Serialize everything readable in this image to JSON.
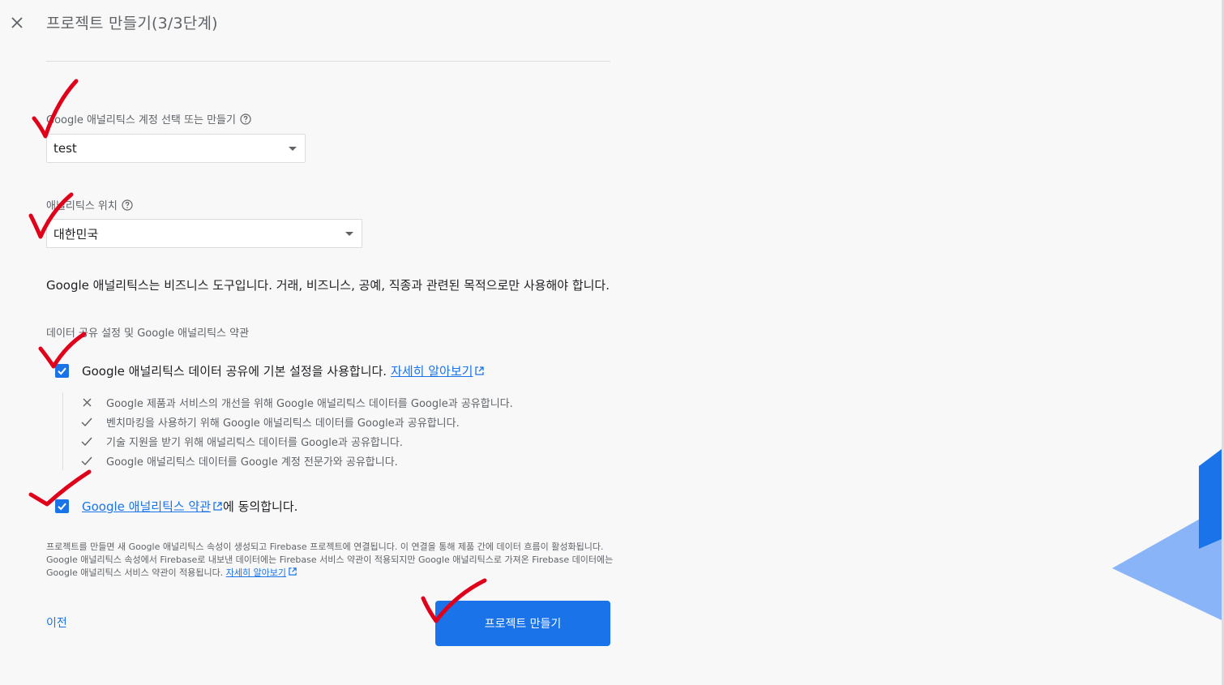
{
  "header": {
    "close_icon": "close-icon",
    "title": "프로젝트 만들기(3/3단계)"
  },
  "account_field": {
    "label": "Google 애널리틱스 계정 선택 또는 만들기",
    "value": "test"
  },
  "location_field": {
    "label": "애널리틱스 위치",
    "value": "대한민국"
  },
  "notice": "Google 애널리틱스는 비즈니스 도구입니다. 거래, 비즈니스, 공예, 직종과 관련된 목적으로만 사용해야 합니다.",
  "data_sharing": {
    "section_label": "데이터 공유 설정 및 Google 애널리틱스 약관",
    "checkbox_text": "Google 애널리틱스 데이터 공유에 기본 설정을 사용합니다.",
    "learn_more": "자세히 알아보기",
    "checked": true,
    "items": [
      {
        "icon": "x-icon",
        "text": "Google 제품과 서비스의 개선을 위해 Google 애널리틱스 데이터를 Google과 공유합니다."
      },
      {
        "icon": "check-icon",
        "text": "벤치마킹을 사용하기 위해 Google 애널리틱스 데이터를 Google과 공유합니다."
      },
      {
        "icon": "check-icon",
        "text": "기술 지원을 받기 위해 애널리틱스 데이터를 Google과 공유합니다."
      },
      {
        "icon": "check-icon",
        "text": "Google 애널리틱스 데이터를 Google 계정 전문가와 공유합니다."
      }
    ]
  },
  "terms": {
    "link_text": "Google 애널리틱스 약관",
    "suffix": "에 동의합니다.",
    "checked": true
  },
  "footnote": {
    "text": "프로젝트를 만들면 새 Google 애널리틱스 속성이 생성되고 Firebase 프로젝트에 연결됩니다. 이 연결을 통해 제품 간에 데이터 흐름이 활성화됩니다. Google 애널리틱스 속성에서 Firebase로 내보낸 데이터에는 Firebase 서비스 약관이 적용되지만 Google 애널리틱스로 가져온 Firebase 데이터에는 Google 애널리틱스 서비스 약관이 적용됩니다.",
    "learn_more": "자세히 알아보기"
  },
  "actions": {
    "prev": "이전",
    "create": "프로젝트 만들기"
  },
  "colors": {
    "primary": "#1a73e8",
    "annotation": "#e0001a"
  }
}
